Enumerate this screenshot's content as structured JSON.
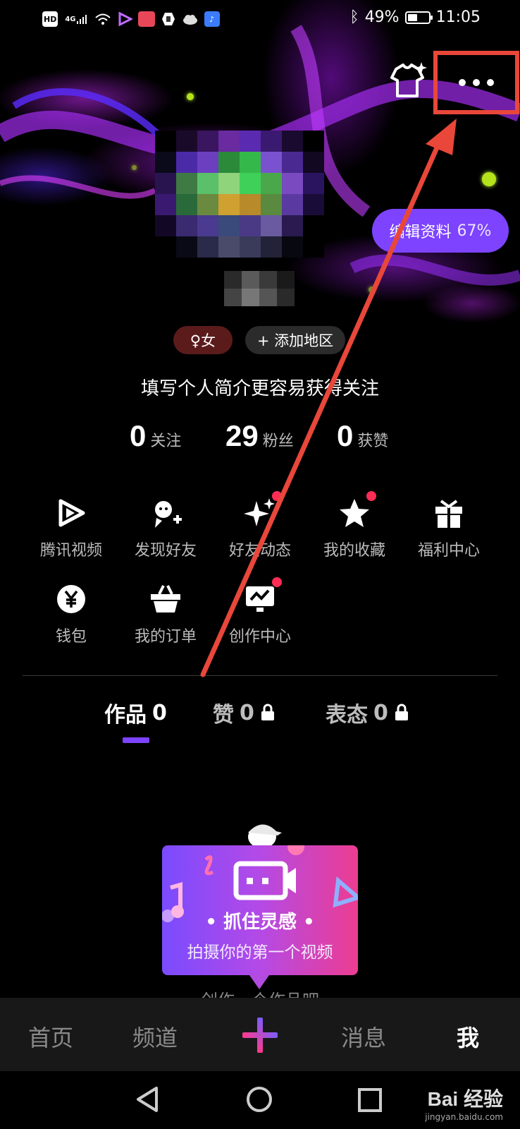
{
  "status_bar": {
    "left_icons": [
      "hd-icon",
      "signal-4g-icon",
      "wifi-icon",
      "tencent-video-icon",
      "app-icon",
      "hand-icon",
      "cloud-icon",
      "music-icon"
    ],
    "hd_label": "HD",
    "net_label": "4G",
    "battery_level_percent": 49,
    "battery_text": "49%",
    "time": "11:05"
  },
  "profile": {
    "edit_label": "编辑资料",
    "edit_progress": "67%",
    "gender_tag": "♀女",
    "region_tag": "+ 添加地区",
    "bio_placeholder": "填写个人简介更容易获得关注",
    "stats": [
      {
        "num": "0",
        "label": "关注"
      },
      {
        "num": "29",
        "label": "粉丝"
      },
      {
        "num": "0",
        "label": "获赞"
      }
    ]
  },
  "features": [
    {
      "label": "腾讯视频",
      "icon": "tencent-video-icon",
      "badge": false
    },
    {
      "label": "发现好友",
      "icon": "add-friend-icon",
      "badge": false
    },
    {
      "label": "好友动态",
      "icon": "sparkle-icon",
      "badge": true
    },
    {
      "label": "我的收藏",
      "icon": "star-icon",
      "badge": true
    },
    {
      "label": "福利中心",
      "icon": "gift-icon",
      "badge": false
    },
    {
      "label": "钱包",
      "icon": "wallet-yuan-icon",
      "badge": false
    },
    {
      "label": "我的订单",
      "icon": "basket-icon",
      "badge": false
    },
    {
      "label": "创作中心",
      "icon": "creator-monitor-icon",
      "badge": true
    }
  ],
  "tabs": [
    {
      "label": "作品",
      "count": "0",
      "locked": false
    },
    {
      "label": "赞",
      "count": "0",
      "locked": true
    },
    {
      "label": "表态",
      "count": "0",
      "locked": true
    }
  ],
  "empty_state": {
    "promo_title": "• 抓住灵感 •",
    "promo_sub": "拍摄你的第一个视频",
    "hint": "创作一个作品吧"
  },
  "bottom_nav": {
    "items": [
      "首页",
      "频道",
      "消息",
      "我"
    ],
    "active": "我"
  },
  "watermark": {
    "brand": "Bai 经验",
    "url": "jingyan.baidu.com"
  },
  "colors": {
    "accent": "#7d43ff",
    "highlight_box": "#e8473a",
    "badge": "#ff2d55",
    "background": "#000000"
  }
}
